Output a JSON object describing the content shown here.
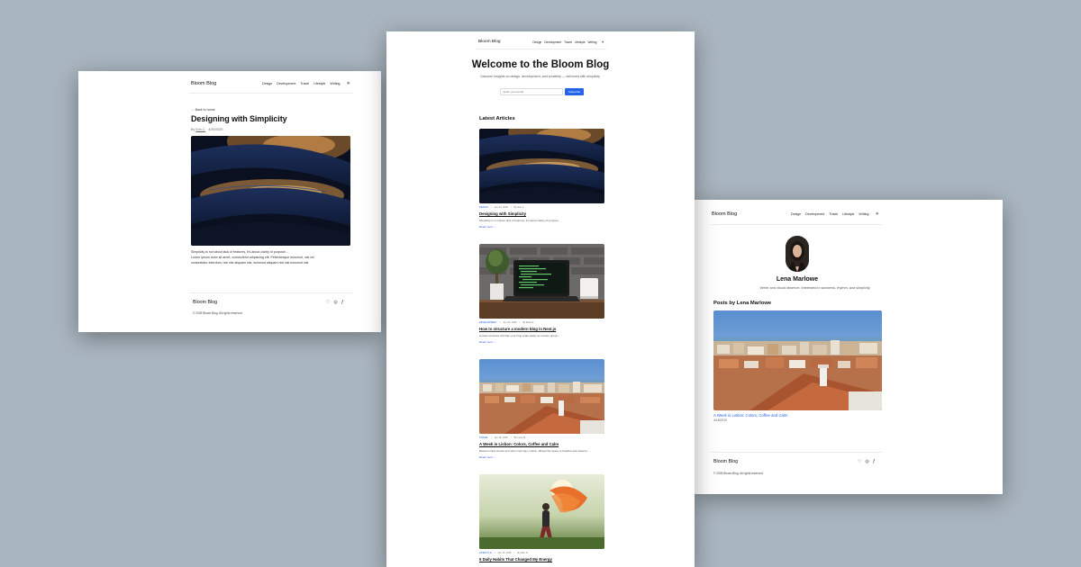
{
  "site": {
    "brand": "Bloom Blog",
    "nav": [
      "Design",
      "Development",
      "Travel",
      "Lifestyle",
      "Writing"
    ],
    "footer_brand": "Bloom Blog",
    "footer_copy": "© 2025 Bloom Blog. All rights reserved.",
    "socials": [
      "twitter-icon",
      "instagram-icon",
      "facebook-icon"
    ]
  },
  "post_page": {
    "back_link": "← Back to home",
    "title": "Designing with Simplicity",
    "meta_by": "By",
    "author": "Erin C.",
    "date": "4/20/2025",
    "body_lines": [
      "Simplicity is not about lack of features, it's about clarity of purpose...",
      "Lorem ipsum dolor sit amet, consectetur adipiscing elit. Pellentesque euismod, nisi vel",
      "consectetur interdum, nisl nisi aliquam nisi, euismod aliquam nisl nisl euismod nisl."
    ]
  },
  "home_page": {
    "hero_title": "Welcome to the Bloom Blog",
    "hero_subtitle": "Discover insights on design, development, and creativity — delivered with simplicity.",
    "email_placeholder": "Enter your email",
    "subscribe_label": "Subscribe",
    "section_title": "Latest Articles",
    "articles": [
      {
        "category": "DESIGN",
        "date": "Apr 24, 2025",
        "author": "By Erin C.",
        "title": "Designing with Simplicity",
        "excerpt": "Simplicity is not about lack of features, it's about clarity of purpose...",
        "read_more": "Read more →"
      },
      {
        "category": "DEVELOPMENT",
        "date": "Apr 26, 2025",
        "author": "By Mark R.",
        "title": "How to structure a modern blog in Next.js",
        "excerpt": "A clean structure will help your blog scale easily as content grows...",
        "read_more": "Read more →"
      },
      {
        "category": "TRAVEL",
        "date": "Apr 18, 2025",
        "author": "By Lena M.",
        "title": "A Week in Lisbon: Colors, Coffee and Calm",
        "excerpt": "Between tiled streets and slow mornings, Lisbon offered the space to breathe and observe...",
        "read_more": "Read more →"
      },
      {
        "category": "LIFESTYLE",
        "date": "Apr 16, 2025",
        "author": "By Alex N.",
        "title": "5 Daily Habits That Changed My Energy",
        "excerpt": "",
        "read_more": ""
      }
    ]
  },
  "author_page": {
    "name": "Lena Marlowe",
    "bio": "Writer and visual observer. Interested in slowness, rhythm, and simplicity.",
    "posts_title": "Posts by Lena Marlowe",
    "featured_title": "A Week in Lisbon: Colors, Coffee and Calm",
    "featured_date": "4/18/2025"
  },
  "colors": {
    "background": "#a9b5bf",
    "accent": "#2563eb"
  }
}
